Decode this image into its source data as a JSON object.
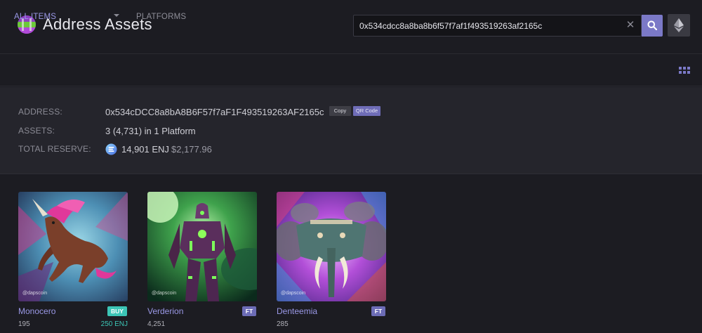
{
  "header": {
    "title": "Address Assets",
    "search": {
      "value": "0x534cdcc8a8ba8b6f57f7af1f493519263af2165c"
    },
    "icons": {
      "logo": "enjin-logo-icon",
      "search": "search-icon",
      "clear": "close-icon",
      "network": "ethereum-icon"
    }
  },
  "nav": {
    "all_items": "ALL ITEMS",
    "platforms": "PLATFORMS"
  },
  "info": {
    "address_label": "ADDRESS:",
    "address_value": "0x534cDCC8a8bA8B6F57f7aF1F493519263AF2165c",
    "copy_label": "Copy",
    "qr_label": "QR Code",
    "assets_label": "ASSETS:",
    "assets_value": "3 (4,731) in 1 Platform",
    "reserve_label": "TOTAL RESERVE:",
    "reserve_enj": "14,901 ENJ",
    "reserve_usd": "$2,177.96"
  },
  "cards": [
    {
      "name": "Monocero",
      "badge": "BUY",
      "count": "195",
      "price": "250 ENJ",
      "watermark": "@dapscoin"
    },
    {
      "name": "Verderion",
      "badge": "FT",
      "count": "4,251",
      "price": "",
      "watermark": "@dapscoin"
    },
    {
      "name": "Denteemia",
      "badge": "FT",
      "count": "285",
      "price": "",
      "watermark": "@dapscoin"
    }
  ],
  "colors": {
    "accent": "#7b79c7",
    "link": "#9a98e6",
    "buy": "#3cc5b6",
    "ft": "#6c6cb6",
    "background": "#1c1c22",
    "panel": "#25252c"
  }
}
